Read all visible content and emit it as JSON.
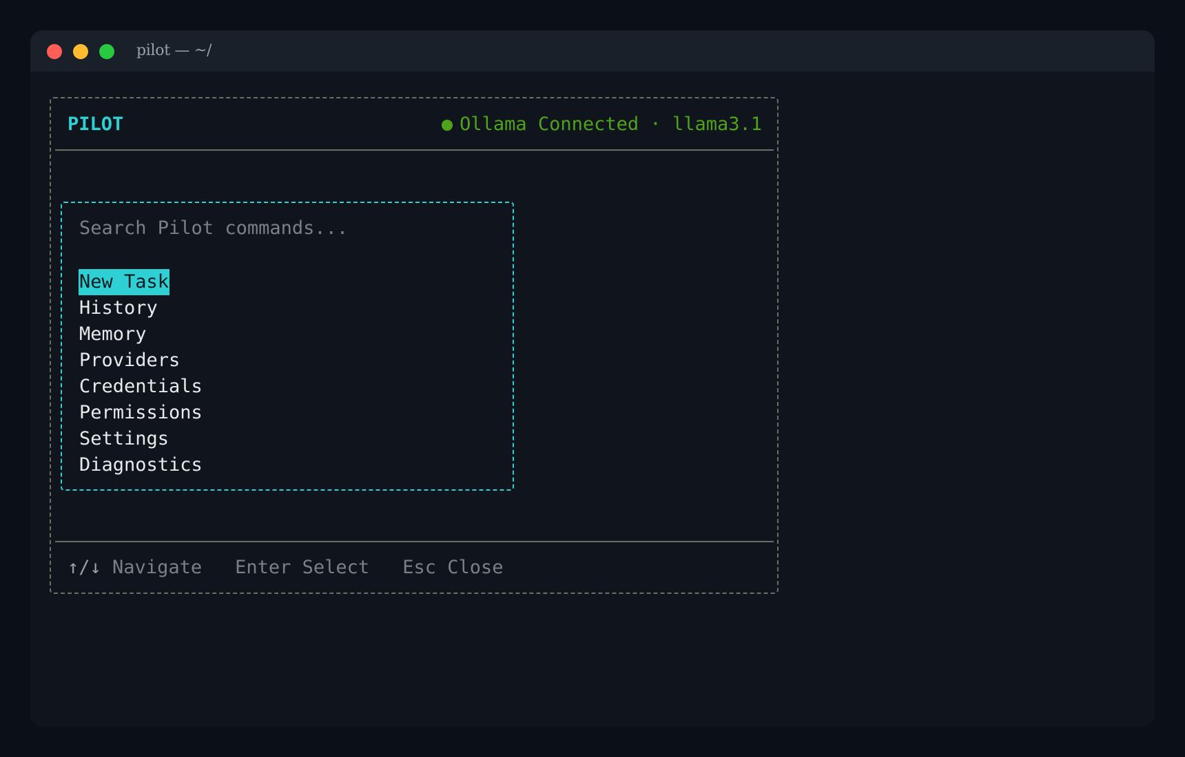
{
  "window": {
    "title": "pilot — ~/"
  },
  "header": {
    "app_name": "PILOT",
    "status_dot": "●",
    "status": "Ollama Connected · llama3.1",
    "status_color": "#4fa31a",
    "accent_color": "#2fd0d3"
  },
  "palette": {
    "search_placeholder": "Search Pilot commands...",
    "selected_index": 0,
    "items": [
      {
        "label": "New Task"
      },
      {
        "label": "History"
      },
      {
        "label": "Memory"
      },
      {
        "label": "Providers"
      },
      {
        "label": "Credentials"
      },
      {
        "label": "Permissions"
      },
      {
        "label": "Settings"
      },
      {
        "label": "Diagnostics"
      }
    ]
  },
  "footer": {
    "navigate_key": "↑/↓",
    "navigate_label": "Navigate",
    "select_key": "Enter",
    "select_label": "Select",
    "close_key": "Esc",
    "close_label": "Close"
  }
}
